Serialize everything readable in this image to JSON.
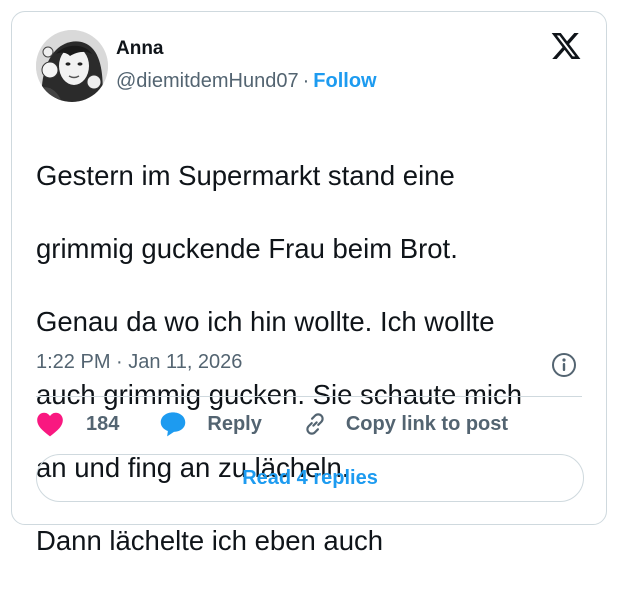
{
  "author": {
    "name": "Anna",
    "handle": "@diemitdemHund07",
    "separator": "·",
    "follow_label": "Follow"
  },
  "tweet": {
    "lines": [
      "Gestern im Supermarkt stand eine",
      "grimmig guckende Frau beim Brot.",
      "Genau da wo ich hin wollte. Ich wollte",
      "auch grimmig gucken. Sie schaute mich",
      "an und fing an zu lächeln.",
      "Dann lächelte ich eben auch"
    ],
    "timestamp": "1:22 PM · Jan 11, 2026"
  },
  "actions": {
    "like_count": "184",
    "reply_label": "Reply",
    "copy_label": "Copy link to post"
  },
  "read_replies_label": "Read 4 replies",
  "icons": {
    "logo": "x-logo-icon",
    "info": "info-icon",
    "like": "heart-icon",
    "reply": "speech-bubble-icon",
    "copy": "link-icon"
  },
  "colors": {
    "accent": "#1d9bf0",
    "like": "#f91880",
    "text": "#0f1419",
    "secondary": "#536471",
    "border": "#cfd9de"
  }
}
